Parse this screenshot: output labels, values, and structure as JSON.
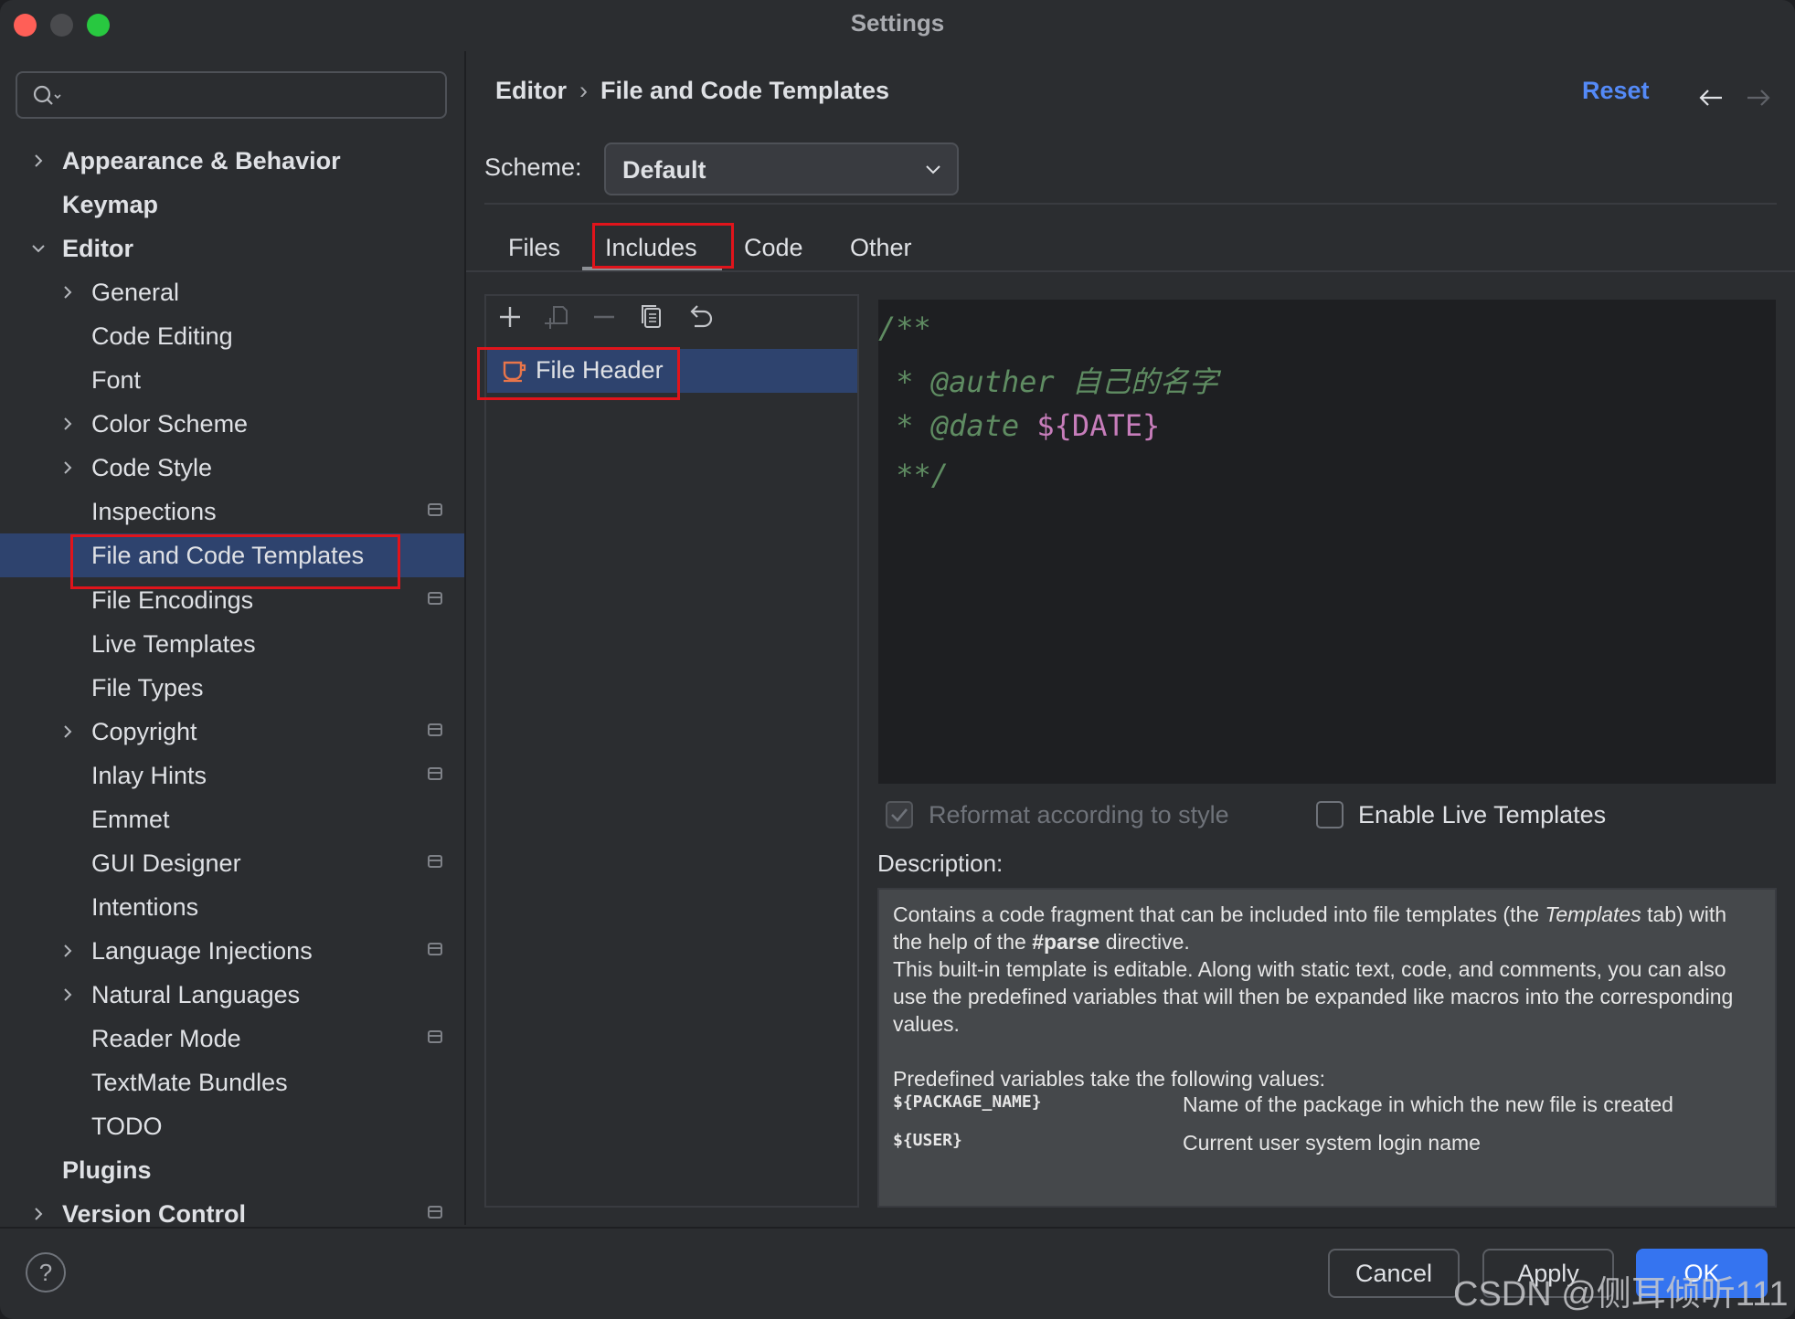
{
  "window": {
    "title": "Settings"
  },
  "search": {
    "placeholder": ""
  },
  "sidebar": {
    "items": [
      {
        "label": "Appearance & Behavior",
        "bold": true,
        "chevron": "right"
      },
      {
        "label": "Keymap",
        "bold": true
      },
      {
        "label": "Editor",
        "bold": true,
        "chevron": "down"
      },
      {
        "label": "General",
        "chevron": "right"
      },
      {
        "label": "Code Editing"
      },
      {
        "label": "Font"
      },
      {
        "label": "Color Scheme",
        "chevron": "right"
      },
      {
        "label": "Code Style",
        "chevron": "right"
      },
      {
        "label": "Inspections",
        "project_icon": true
      },
      {
        "label": "File and Code Templates",
        "selected": true
      },
      {
        "label": "File Encodings",
        "project_icon": true
      },
      {
        "label": "Live Templates"
      },
      {
        "label": "File Types"
      },
      {
        "label": "Copyright",
        "chevron": "right",
        "project_icon": true
      },
      {
        "label": "Inlay Hints",
        "project_icon": true
      },
      {
        "label": "Emmet"
      },
      {
        "label": "GUI Designer",
        "project_icon": true
      },
      {
        "label": "Intentions"
      },
      {
        "label": "Language Injections",
        "chevron": "right",
        "project_icon": true
      },
      {
        "label": "Natural Languages",
        "chevron": "right"
      },
      {
        "label": "Reader Mode",
        "project_icon": true
      },
      {
        "label": "TextMate Bundles"
      },
      {
        "label": "TODO"
      },
      {
        "label": "Plugins",
        "bold": true
      },
      {
        "label": "Version Control",
        "bold": true,
        "chevron": "right",
        "project_icon": true
      }
    ]
  },
  "header": {
    "breadcrumb": [
      "Editor",
      "File and Code Templates"
    ],
    "reset_label": "Reset",
    "back_icon": "arrow-left-icon",
    "forward_icon": "arrow-right-icon"
  },
  "scheme": {
    "label": "Scheme:",
    "value": "Default"
  },
  "tabs": [
    {
      "label": "Files"
    },
    {
      "label": "Includes",
      "selected": true
    },
    {
      "label": "Code"
    },
    {
      "label": "Other"
    }
  ],
  "templates": {
    "toolbar": [
      "add-icon",
      "copy-add-icon",
      "remove-icon",
      "duplicate-icon",
      "revert-icon"
    ],
    "items": [
      {
        "label": "File Header",
        "icon": "java-cup-icon",
        "selected": true
      }
    ]
  },
  "editor": {
    "lines": [
      {
        "text": "/**"
      },
      {
        "text": " * @auther 自己的名字"
      },
      {
        "text": " * @date ",
        "var": "${DATE}"
      },
      {
        "text": " **/"
      }
    ]
  },
  "options": {
    "reformat": {
      "label": "Reformat according to style",
      "checked": true,
      "enabled": false
    },
    "live_templates": {
      "label": "Enable Live Templates",
      "checked": false
    }
  },
  "description": {
    "label": "Description:",
    "p1_a": "Contains a code fragment that can be included into file templates (the ",
    "p1_i": "Templates",
    "p1_b": " tab) with the help of the ",
    "p1_bold": "#parse",
    "p1_c": " directive.",
    "p2": "This built-in template is editable. Along with static text, code, and comments, you can also use the predefined variables that will then be expanded like macros into the corresponding values.",
    "p3": "Predefined variables take the following values:",
    "variables": [
      {
        "name": "${PACKAGE_NAME}",
        "desc": "Name of the package in which the new file is created"
      },
      {
        "name": "${USER}",
        "desc": "Current user system login name"
      }
    ]
  },
  "footer": {
    "help": "?",
    "cancel": "Cancel",
    "apply": "Apply",
    "ok": "OK",
    "watermark": "CSDN @侧耳倾听111"
  },
  "colors": {
    "accent": "#548af7",
    "selection": "#2e436e",
    "highlight_box": "#e0141b",
    "ok_button": "#3574f0"
  }
}
